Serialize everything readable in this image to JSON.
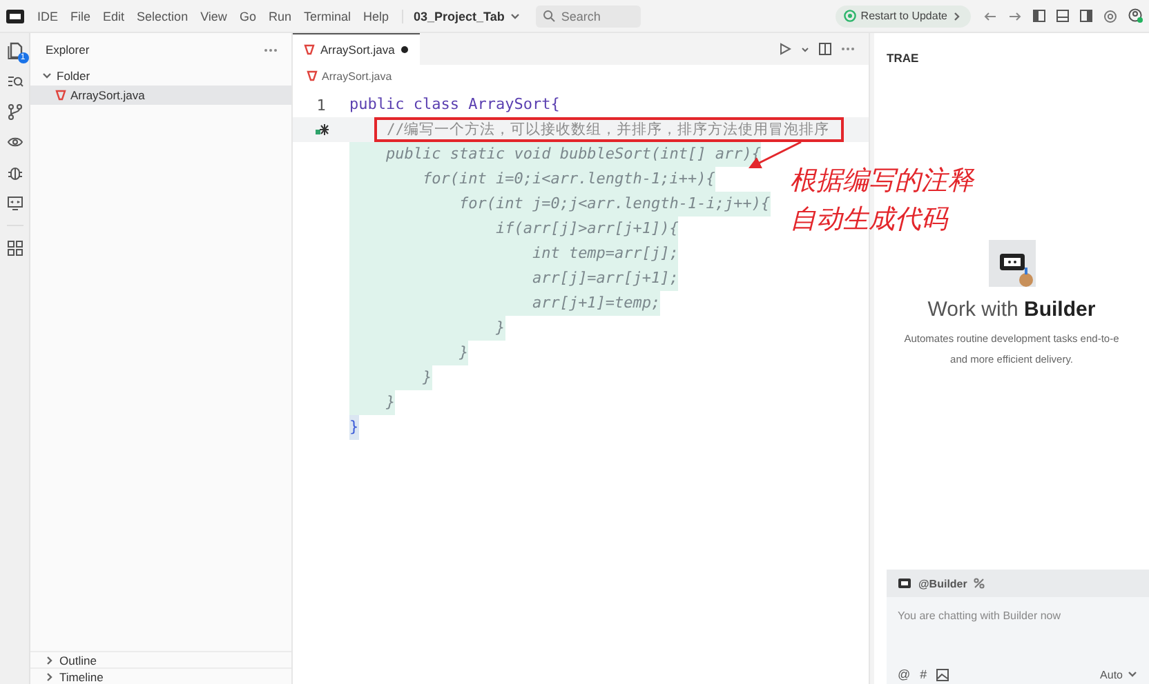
{
  "titlebar": {
    "app_name": "IDE",
    "menu": [
      "File",
      "Edit",
      "Selection",
      "View",
      "Go",
      "Run",
      "Terminal",
      "Help"
    ],
    "project": "03_Project_Tab",
    "search": {
      "placeholder": "Search"
    },
    "update_button": "Restart to Update"
  },
  "activity_bar": {
    "explorer_badge": "1"
  },
  "sidebar": {
    "title": "Explorer",
    "tree": [
      {
        "label": "Folder",
        "expanded": true,
        "children": [
          {
            "label": "ArraySort.java",
            "selected": true
          }
        ]
      }
    ],
    "sections": [
      {
        "label": "Outline",
        "expanded": false
      },
      {
        "label": "Timeline",
        "expanded": false
      }
    ]
  },
  "editor": {
    "tabs": [
      {
        "label": "ArraySort.java",
        "modified": true,
        "selected": true
      }
    ],
    "breadcrumb": "ArraySort.java",
    "lines": [
      {
        "number": "1",
        "text": "public class ArraySort{",
        "kind": "code"
      },
      {
        "text": "    //编写一个方法，可以接收数组，并排序，排序方法使用冒泡排序",
        "kind": "comment"
      },
      {
        "text": "    public static void bubbleSort(int[] arr){",
        "kind": "ghost"
      },
      {
        "text": "        for(int i=0;i<arr.length-1;i++){",
        "kind": "ghost"
      },
      {
        "text": "            for(int j=0;j<arr.length-1-i;j++){",
        "kind": "ghost"
      },
      {
        "text": "                if(arr[j]>arr[j+1]){",
        "kind": "ghost"
      },
      {
        "text": "                    int temp=arr[j];",
        "kind": "ghost"
      },
      {
        "text": "                    arr[j]=arr[j+1];",
        "kind": "ghost"
      },
      {
        "text": "                    arr[j+1]=temp;",
        "kind": "ghost"
      },
      {
        "text": "                }",
        "kind": "ghost"
      },
      {
        "text": "            }",
        "kind": "ghost"
      },
      {
        "text": "        }",
        "kind": "ghost"
      },
      {
        "text": "    }",
        "kind": "ghost"
      },
      {
        "text": "}",
        "kind": "bracket"
      }
    ]
  },
  "annotation": {
    "lines": [
      "根据编写的注释",
      "自动生成代码"
    ]
  },
  "panel": {
    "title": "TRAE",
    "heading": "Work with **Builder**",
    "description": [
      "Automates routine development tasks end-to-e",
      "and more efficient delivery."
    ],
    "chat": {
      "agent": "@Builder",
      "placeholder": "You are chatting with Builder now",
      "tools": [
        "@",
        "#"
      ],
      "mode": "Auto"
    }
  }
}
